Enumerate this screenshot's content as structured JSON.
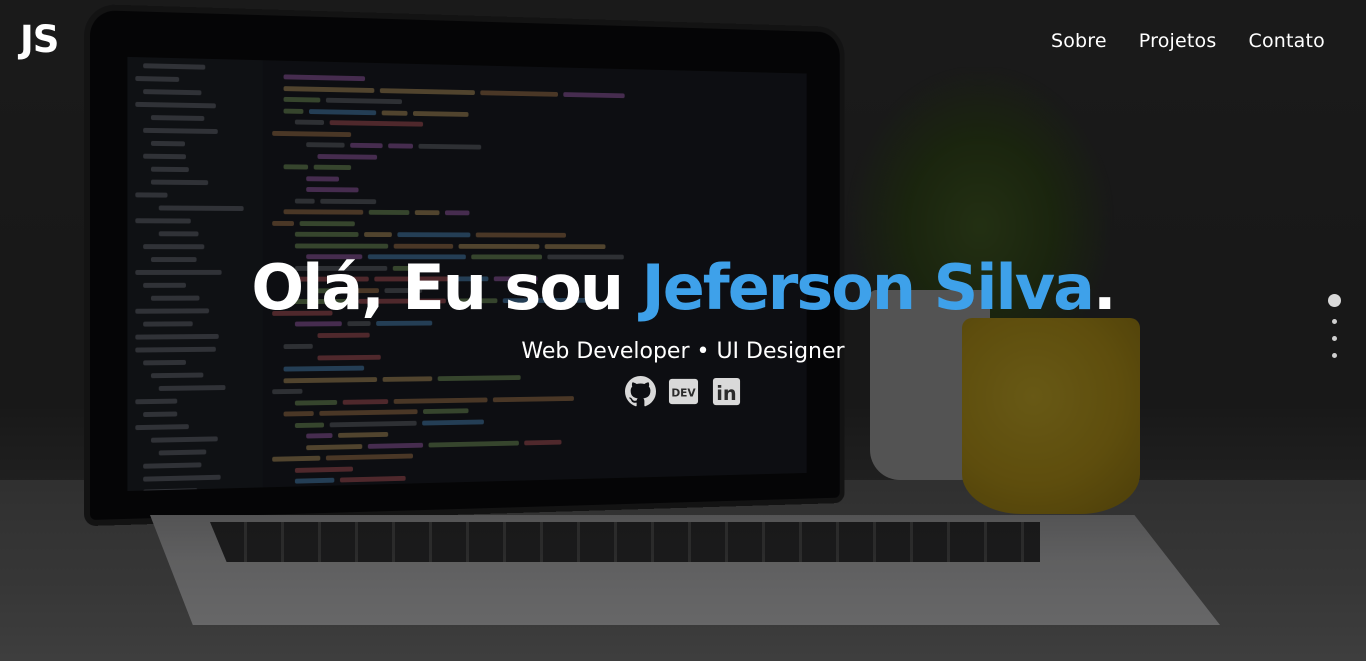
{
  "header": {
    "logo": "JS",
    "nav": [
      {
        "label": "Sobre"
      },
      {
        "label": "Projetos"
      },
      {
        "label": "Contato"
      }
    ]
  },
  "hero": {
    "greeting": "Olá, Eu sou ",
    "name": "Jeferson Silva",
    "period": ".",
    "subtitle": "Web Developer • UI Designer",
    "socials": [
      {
        "icon": "github-icon"
      },
      {
        "icon": "dev-icon",
        "text": "DEV"
      },
      {
        "icon": "linkedin-icon",
        "text": "in"
      }
    ]
  },
  "section_nav": {
    "count": 4,
    "active": 0
  },
  "colors": {
    "accent": "#3ea1ea",
    "text": "#ffffff",
    "overlay": "rgba(0,0,0,0.55)"
  }
}
